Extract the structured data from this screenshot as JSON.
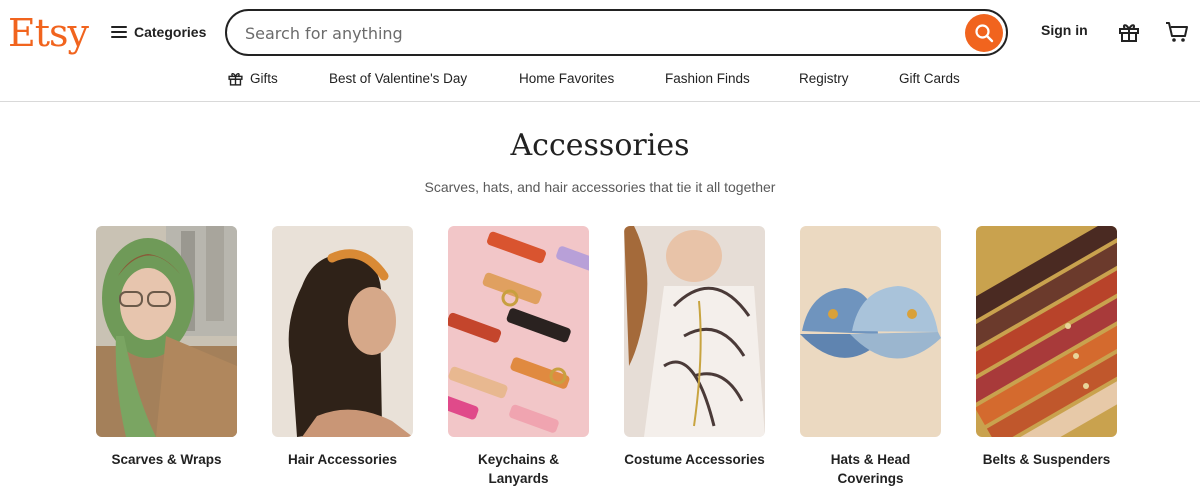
{
  "header": {
    "logo": "Etsy",
    "categories_label": "Categories",
    "search_placeholder": "Search for anything",
    "signin_label": "Sign in"
  },
  "nav": [
    {
      "label": "Gifts",
      "icon": "gift-icon"
    },
    {
      "label": "Best of Valentine's Day"
    },
    {
      "label": "Home Favorites"
    },
    {
      "label": "Fashion Finds"
    },
    {
      "label": "Registry"
    },
    {
      "label": "Gift Cards"
    }
  ],
  "page": {
    "title": "Accessories",
    "subtitle": "Scarves, hats, and hair accessories that tie it all together"
  },
  "categories": [
    {
      "label": "Scarves & Wraps"
    },
    {
      "label": "Hair Accessories"
    },
    {
      "label": "Keychains & Lanyards"
    },
    {
      "label": "Costume Accessories"
    },
    {
      "label": "Hats & Head Coverings"
    },
    {
      "label": "Belts & Suspenders"
    }
  ],
  "colors": {
    "brand": "#F1641E",
    "text": "#222222",
    "muted": "#595959"
  }
}
